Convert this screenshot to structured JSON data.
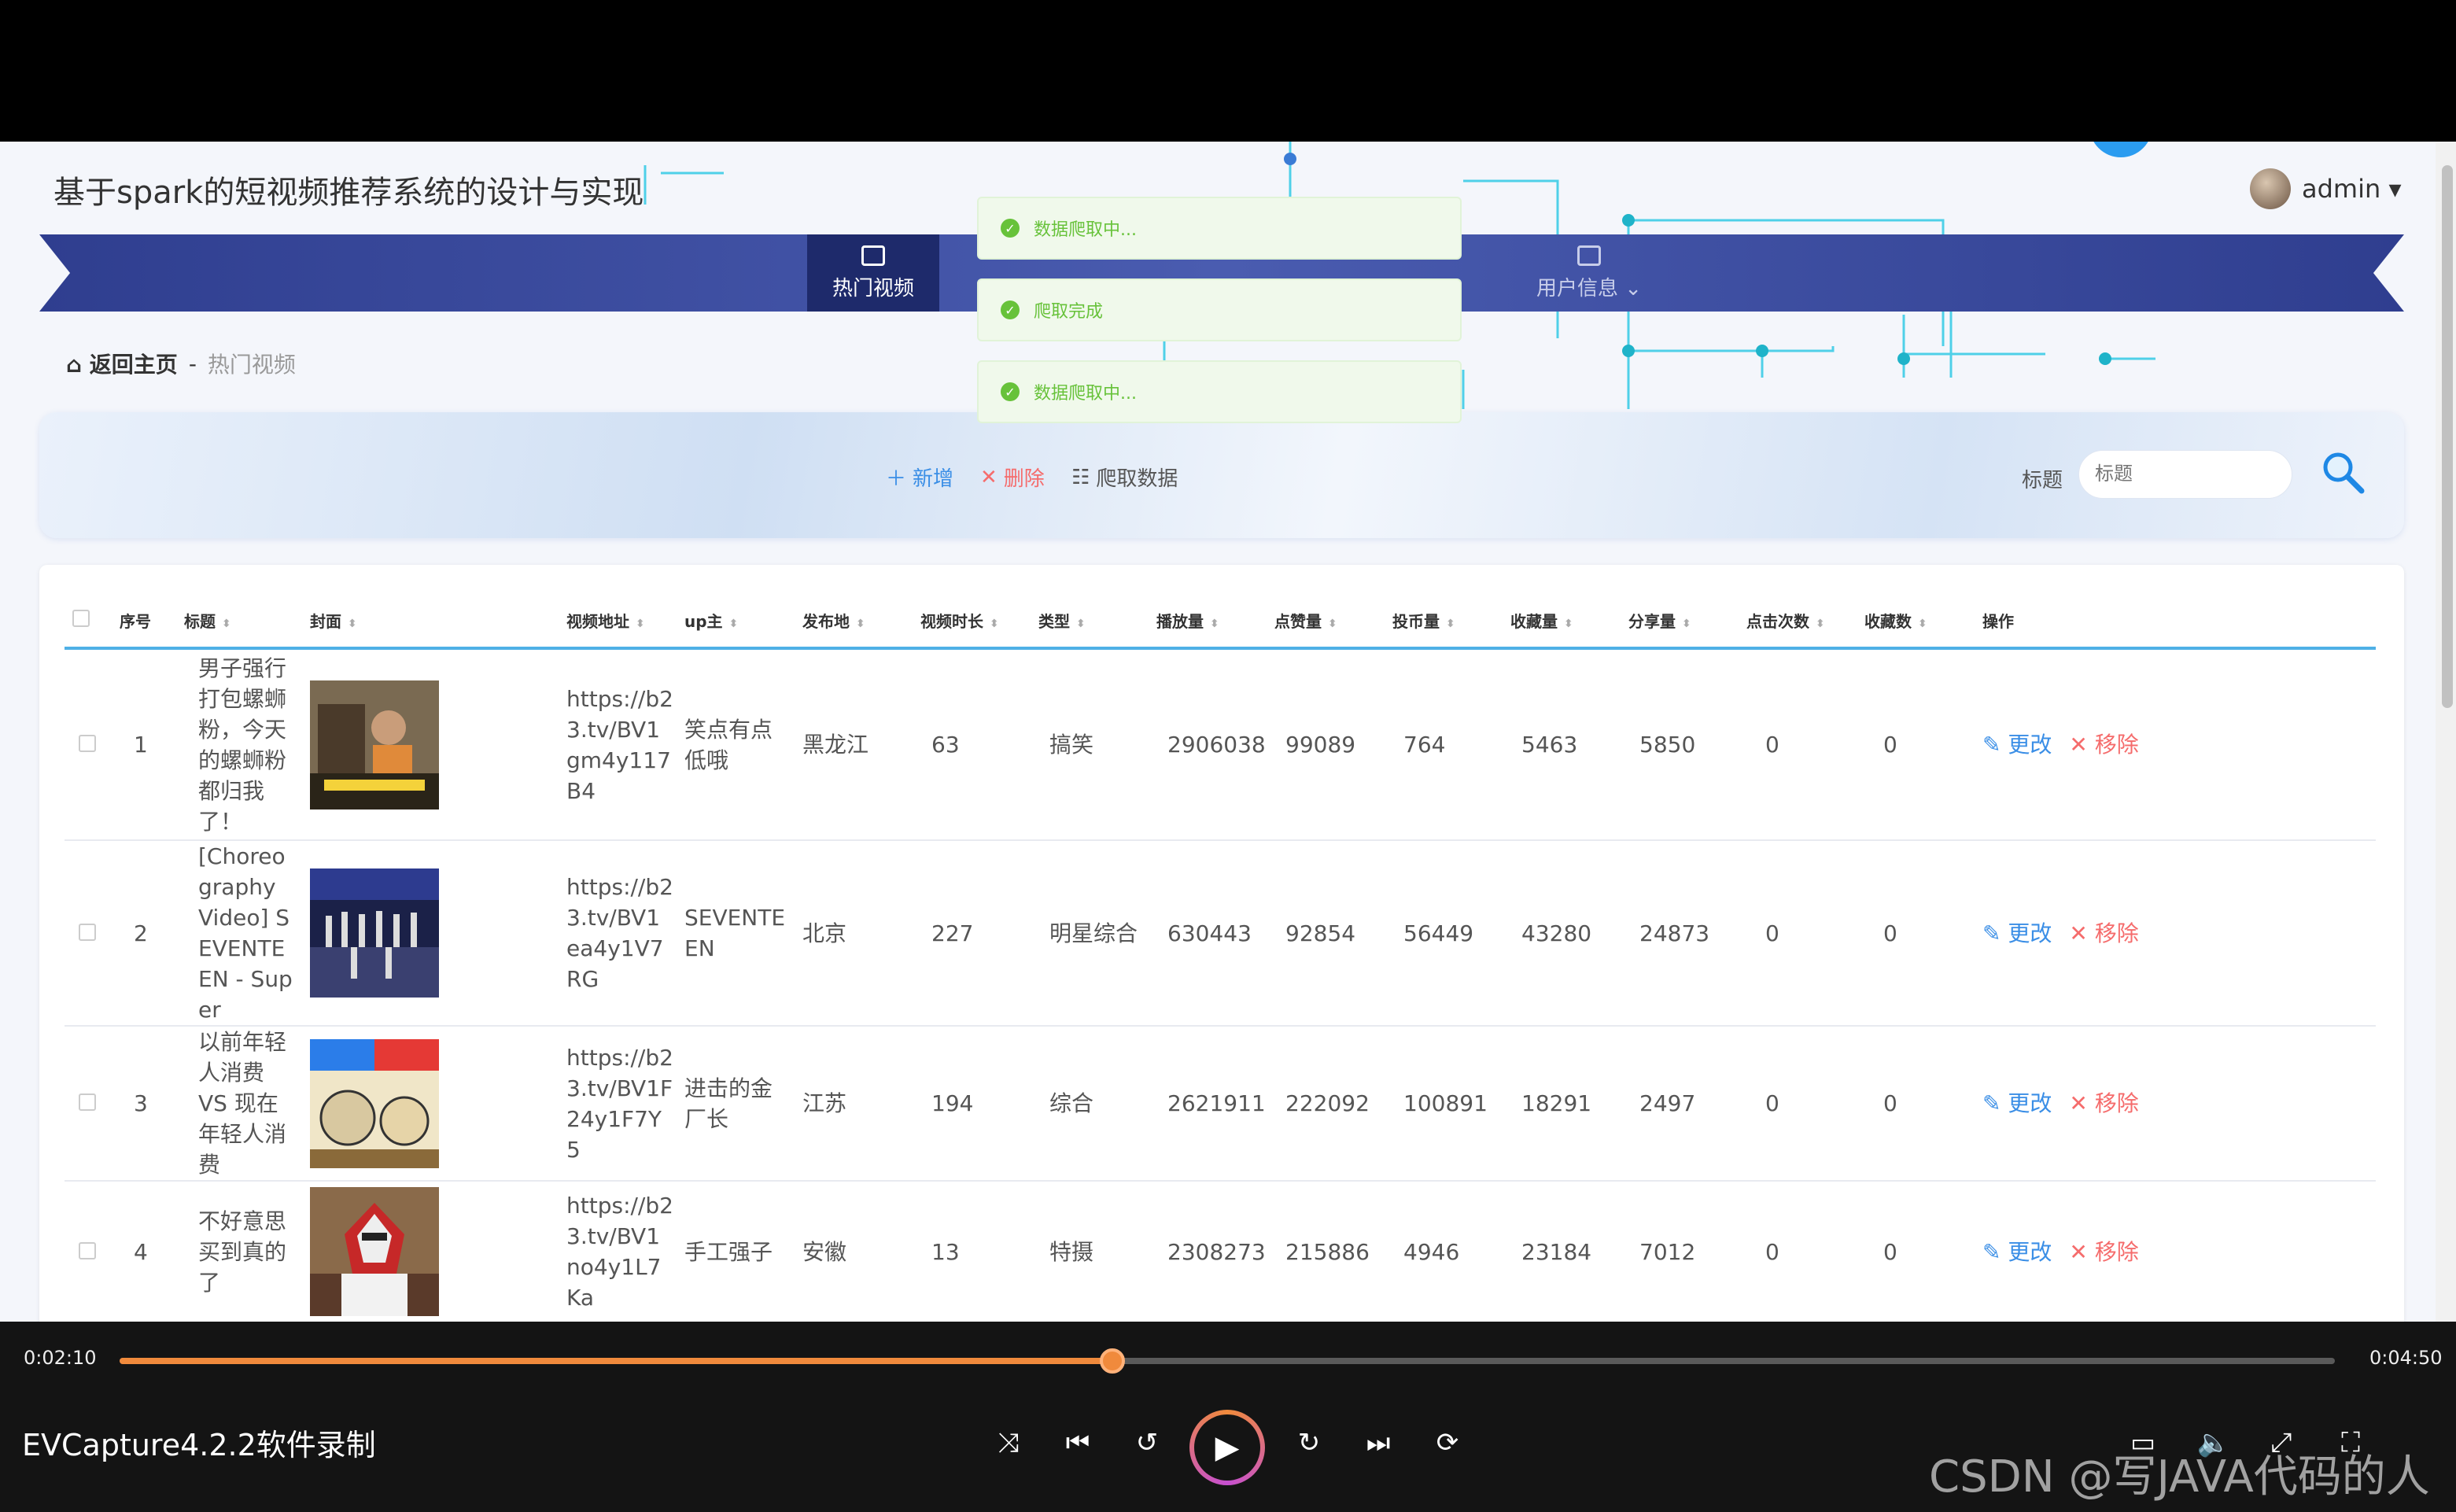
{
  "app": {
    "title": "基于spark的短视频推荐系统的设计与实现",
    "user": "admin ▾"
  },
  "nav": {
    "items": [
      {
        "label": "热门视频",
        "active": true
      },
      {
        "label": "用户信息 ⌄",
        "active": false
      }
    ]
  },
  "breadcrumb": {
    "home": "返回主页",
    "sep": "-",
    "current": "热门视频"
  },
  "toolbar": {
    "add_label": "新增",
    "delete_label": "删除",
    "crawl_label": "爬取数据",
    "search_label": "标题",
    "search_placeholder": "标题"
  },
  "toasts": [
    {
      "text": "数据爬取中..."
    },
    {
      "text": "爬取完成"
    },
    {
      "text": "数据爬取中..."
    }
  ],
  "table": {
    "headers": [
      "序号",
      "标题",
      "封面",
      "视频地址",
      "up主",
      "发布地",
      "视频时长",
      "类型",
      "播放量",
      "点赞量",
      "投币量",
      "收藏量",
      "分享量",
      "点击次数",
      "收藏数",
      "操作"
    ],
    "rows": [
      {
        "index": "1",
        "title": "男子强行打包螺蛳粉，今天的螺蛳粉都归我了！",
        "url": "https://b23.tv/BV1gm4y117B4",
        "up": "笑点有点低哦",
        "place": "黑龙江",
        "duration": "63",
        "type": "搞笑",
        "plays": "2906038",
        "likes": "99089",
        "coins": "764",
        "favs": "5463",
        "shares": "5850",
        "clicks": "0",
        "collects": "0",
        "edit": "更改",
        "remove": "移除"
      },
      {
        "index": "2",
        "title": "[Choreography Video] SEVENTEEN - Super",
        "url": "https://b23.tv/BV1ea4y1V7RG",
        "up": "SEVENTEEN",
        "place": "北京",
        "duration": "227",
        "type": "明星综合",
        "plays": "630443",
        "likes": "92854",
        "coins": "56449",
        "favs": "43280",
        "shares": "24873",
        "clicks": "0",
        "collects": "0",
        "edit": "更改",
        "remove": "移除"
      },
      {
        "index": "3",
        "title": "以前年轻人消费 VS 现在年轻人消费",
        "url": "https://b23.tv/BV1F24y1F7Y5",
        "up": "进击的金厂长",
        "place": "江苏",
        "duration": "194",
        "type": "综合",
        "plays": "2621911",
        "likes": "222092",
        "coins": "100891",
        "favs": "18291",
        "shares": "2497",
        "clicks": "0",
        "collects": "0",
        "edit": "更改",
        "remove": "移除"
      },
      {
        "index": "4",
        "title": "不好意思买到真的了",
        "url": "https://b23.tv/BV1no4y1L7Ka",
        "up": "手工强子",
        "place": "安徽",
        "duration": "13",
        "type": "特摄",
        "plays": "2308273",
        "likes": "215886",
        "coins": "4946",
        "favs": "23184",
        "shares": "7012",
        "clicks": "0",
        "collects": "0",
        "edit": "更改",
        "remove": "移除"
      }
    ]
  },
  "player": {
    "current_time": "0:02:10",
    "total_time": "0:04:50",
    "progress": 0.448,
    "brand": "EVCapture4.2.2软件录制"
  },
  "watermark": "CSDN @写JAVA代码的人"
}
